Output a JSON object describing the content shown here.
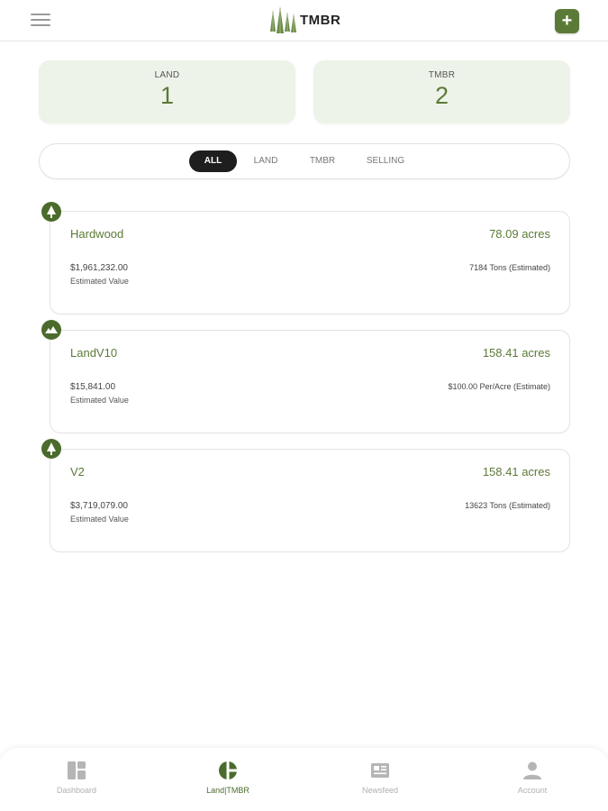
{
  "header": {
    "logo_text": "TMBR",
    "menu_icon": "hamburger-menu-icon",
    "add_icon": "+"
  },
  "stats": [
    {
      "label": "LAND",
      "value": "1"
    },
    {
      "label": "TMBR",
      "value": "2"
    }
  ],
  "filters": [
    {
      "label": "ALL",
      "active": true
    },
    {
      "label": "LAND",
      "active": false
    },
    {
      "label": "TMBR",
      "active": false
    },
    {
      "label": "SELLING",
      "active": false
    }
  ],
  "properties": [
    {
      "icon": "tree-icon",
      "name": "Hardwood",
      "acres": "78.09 acres",
      "value": "$1,961,232.00",
      "value_label": "Estimated Value",
      "detail": "7184 Tons (Estimated)"
    },
    {
      "icon": "land-icon",
      "name": "LandV10",
      "acres": "158.41 acres",
      "value": "$15,841.00",
      "value_label": "Estimated Value",
      "detail": "$100.00 Per/Acre (Estimate)"
    },
    {
      "icon": "tree-icon",
      "name": "V2",
      "acres": "158.41 acres",
      "value": "$3,719,079.00",
      "value_label": "Estimated Value",
      "detail": "13623 Tons (Estimated)"
    }
  ],
  "nav": [
    {
      "label": "Dashboard",
      "icon": "dashboard-icon",
      "active": false
    },
    {
      "label": "Land|TMBR",
      "icon": "land-tmbr-icon",
      "active": true
    },
    {
      "label": "Newsfeed",
      "icon": "newsfeed-icon",
      "active": false
    },
    {
      "label": "Account",
      "icon": "account-icon",
      "active": false
    }
  ],
  "colors": {
    "accent": "#5c7a37",
    "icon_bg": "#4b6b2c",
    "card_bg": "#eef3ea",
    "active_chip": "#1e1e1e"
  }
}
